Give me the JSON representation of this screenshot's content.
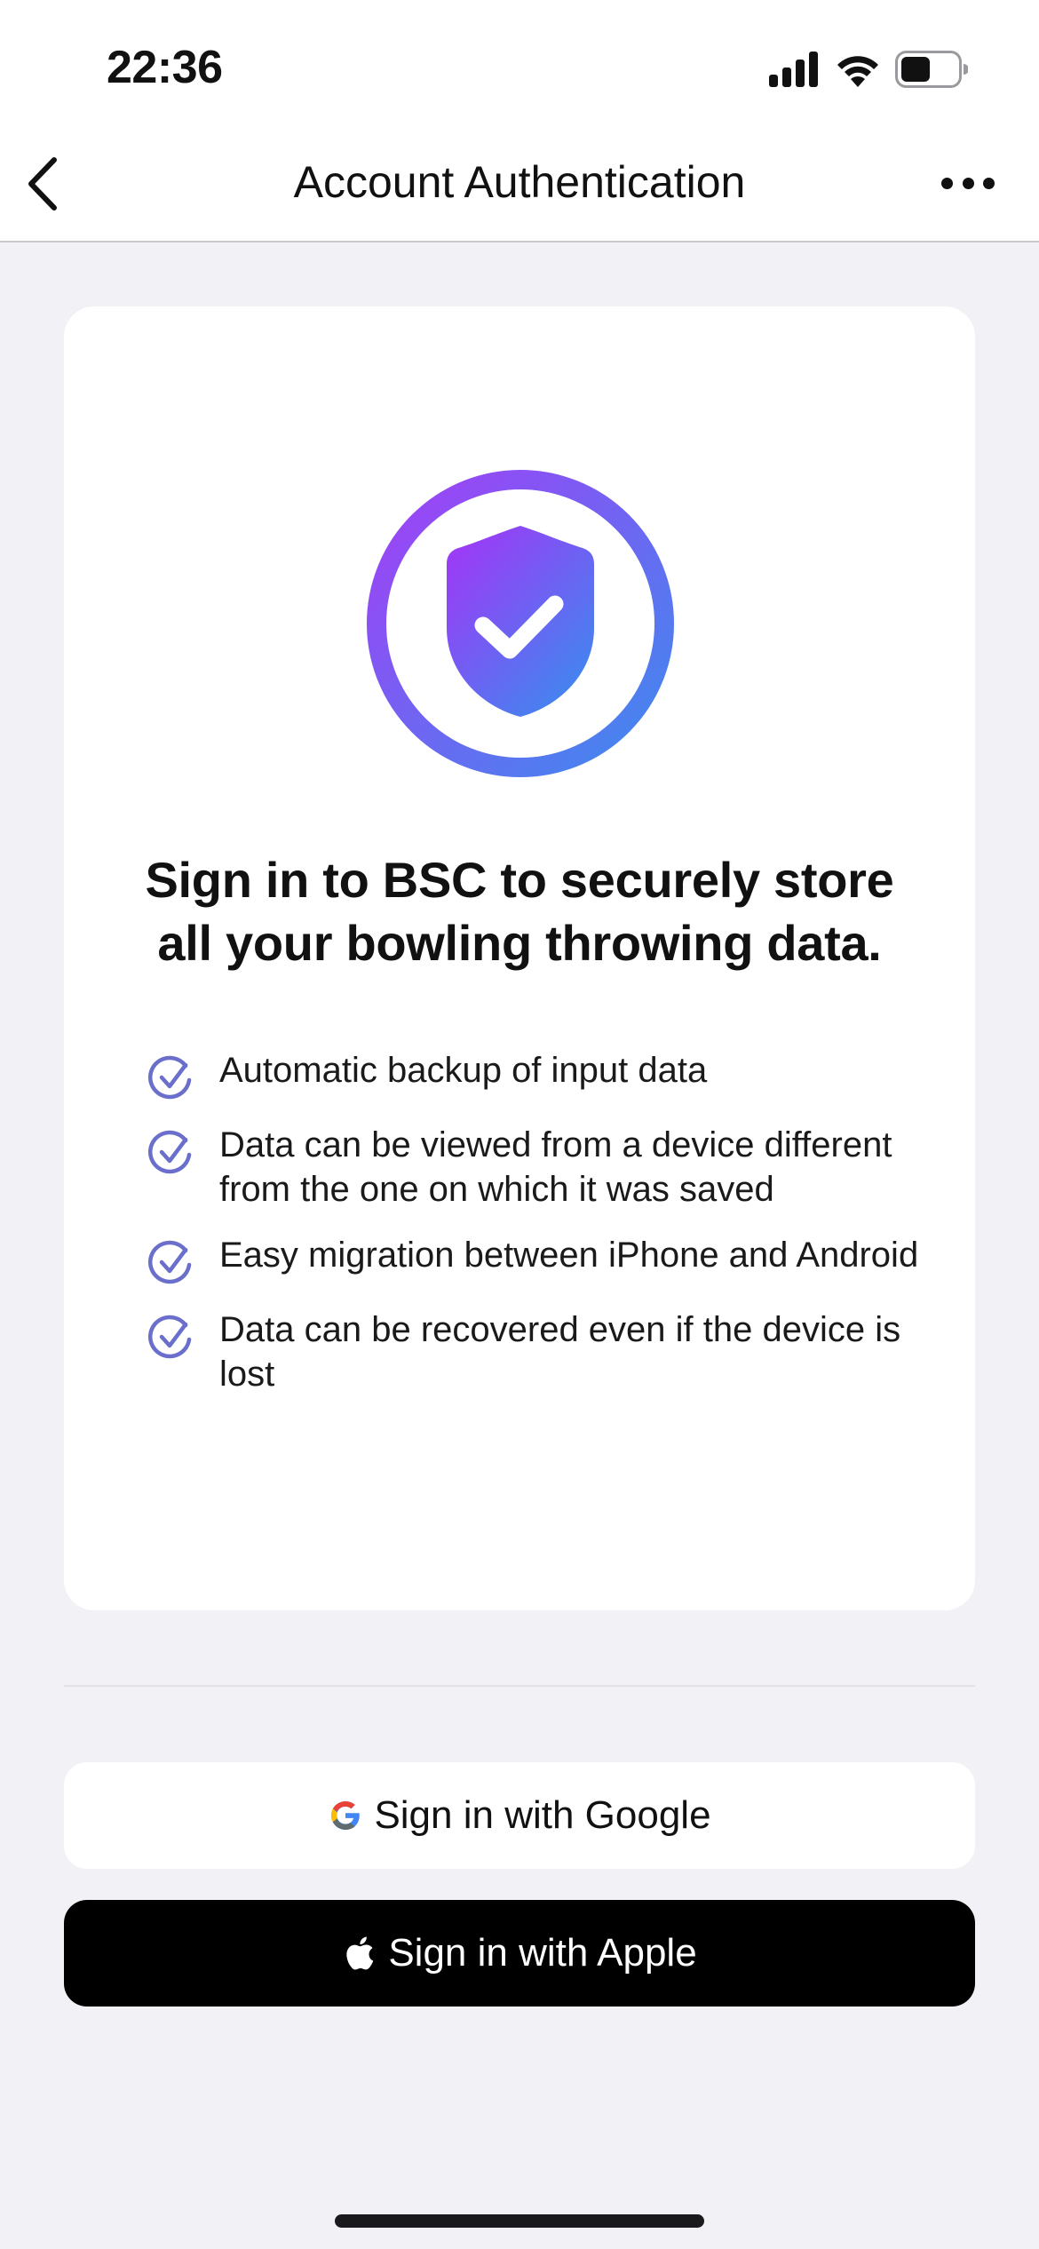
{
  "status_bar": {
    "time": "22:36",
    "icons": [
      "cellular-signal-icon",
      "wifi-icon",
      "battery-icon"
    ],
    "battery_level_fraction": 0.5
  },
  "nav": {
    "back_icon": "chevron-left-icon",
    "title": "Account Authentication",
    "more_icon": "ellipsis-icon"
  },
  "card": {
    "hero_icon": "shield-check-icon",
    "headline_line1": "Sign in to BSC to securely store",
    "headline_line2": "all your bowling throwing data.",
    "benefits": [
      {
        "icon": "check-circle-icon",
        "text": "Automatic backup of input data"
      },
      {
        "icon": "check-circle-icon",
        "text": "Data can be viewed from a device different from the one on which it was saved"
      },
      {
        "icon": "check-circle-icon",
        "text": "Easy migration between iPhone and Android"
      },
      {
        "icon": "check-circle-icon",
        "text": "Data can be recovered even if the device is lost"
      }
    ]
  },
  "buttons": {
    "google": {
      "label": "Sign in with Google",
      "icon": "google-logo-icon"
    },
    "apple": {
      "label": "Sign in with Apple",
      "icon": "apple-logo-icon"
    }
  },
  "colors": {
    "background": "#f1f1f6",
    "card": "#ffffff",
    "accent_gradient_start": "#9b3ff5",
    "accent_gradient_end": "#3f86ee",
    "check_icon": "#6a6fcb",
    "apple_button": "#000000",
    "google_button": "#ffffff"
  }
}
